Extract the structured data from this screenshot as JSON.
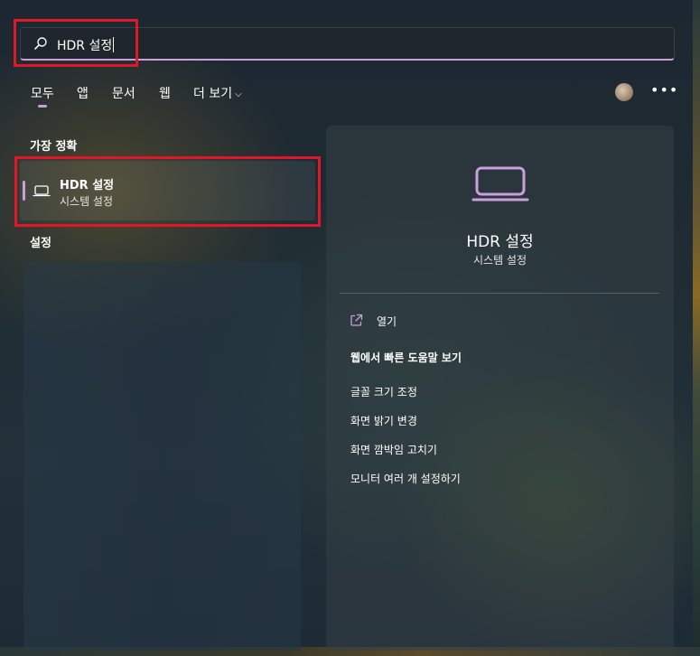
{
  "search": {
    "query": "HDR 설정"
  },
  "tabs": [
    {
      "label": "모두"
    },
    {
      "label": "앱"
    },
    {
      "label": "문서"
    },
    {
      "label": "웹"
    },
    {
      "label": "더 보기"
    }
  ],
  "sections": {
    "best_match": "가장 정확",
    "settings": "설정"
  },
  "best_match_result": {
    "title": "HDR 설정",
    "subtitle": "시스템 설정",
    "icon": "laptop-icon"
  },
  "detail": {
    "title": "HDR 설정",
    "subtitle": "시스템 설정",
    "icon": "laptop-icon",
    "open_label": "열기",
    "web_heading": "웹에서 빠른 도움말 보기",
    "suggestions": [
      "글꼴 크기 조정",
      "화면 밝기 변경",
      "화면 깜박임 고치기",
      "모니터 여러 개 설정하기"
    ]
  },
  "colors": {
    "accent": "#c9a0dc",
    "highlight_box": "#e0162b"
  }
}
